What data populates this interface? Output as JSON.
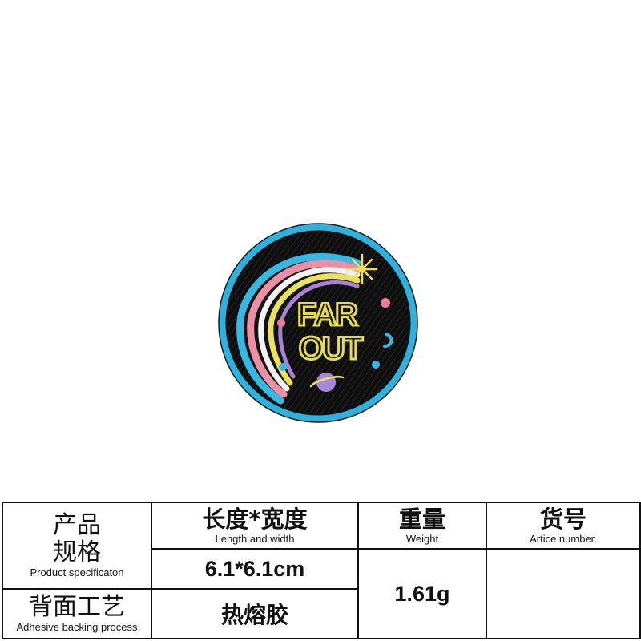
{
  "patch": {
    "text_line1": "FAR",
    "text_line2": "OUT",
    "colors": {
      "background": "#0e0e0e",
      "border": "#2fb1de",
      "rainbow_outer": "#35b8e2",
      "rainbow_pink": "#ec8fa4",
      "rainbow_white": "#f2f2f2",
      "rainbow_yellow": "#e9e25a",
      "rainbow_purple": "#a882d6",
      "text": "#e6dc4c",
      "star": "#eede5a",
      "planet": "#a886da",
      "dot_pink": "#ec7e93",
      "dot_blue": "#3ab6e3"
    },
    "icons": [
      "star-icon",
      "planet-icon"
    ]
  },
  "spec_table": {
    "product_spec": {
      "cn_line1": "产品",
      "cn_line2": "规格",
      "en": "Product specificaton"
    },
    "size": {
      "cn": "长度*宽度",
      "en": "Length and width",
      "value": "6.1*6.1cm"
    },
    "weight": {
      "cn": "重量",
      "en": "Weight",
      "value": "1.61g"
    },
    "article": {
      "cn": "货号",
      "en": "Artice number.",
      "value": ""
    },
    "backing": {
      "cn": "背面工艺",
      "en": "Adhesive backing process",
      "value": "热熔胶"
    }
  }
}
